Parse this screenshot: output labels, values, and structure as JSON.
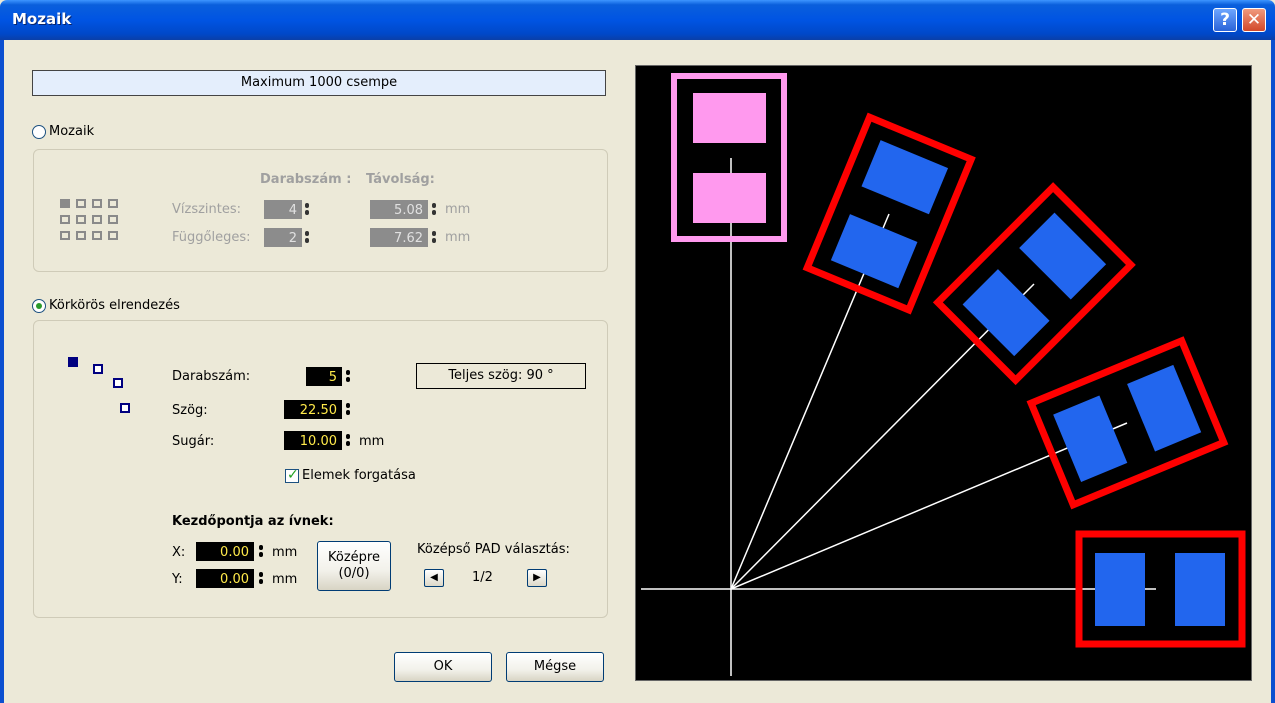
{
  "window": {
    "title": "Mozaik",
    "help_glyph": "?",
    "close_glyph": "✕"
  },
  "info": {
    "text": "Maximum 1000 csempe"
  },
  "mosaic": {
    "radio_label": "Mozaik",
    "selected": false,
    "col_count_header": "Darabszám :",
    "col_distance_header": "Távolság:",
    "rows": [
      {
        "label": "Vízszintes:",
        "count": "4",
        "distance": "5.08",
        "unit": "mm"
      },
      {
        "label": "Függőleges:",
        "count": "2",
        "distance": "7.62",
        "unit": "mm"
      }
    ],
    "grid_icon": "grid-icon"
  },
  "circular": {
    "radio_label": "Körkörös elrendezés",
    "selected": true,
    "count_label": "Darabszám:",
    "count_value": "5",
    "angle_label": "Szög:",
    "angle_value": "22.50",
    "radius_label": "Sugár:",
    "radius_value": "10.00",
    "radius_unit": "mm",
    "total_angle_text": "Teljes szög:   90 °",
    "rotate_label": "Elemek forgatása",
    "rotate_checked": true,
    "arc_start_title": "Kezdőpontja az ívnek:",
    "x_label": "X:",
    "x_value": "0.00",
    "y_label": "Y:",
    "y_value": "0.00",
    "coord_unit": "mm",
    "center_button_line1": "Középre",
    "center_button_line2": "(0/0)",
    "pad_select_label": "Középső PAD választás:",
    "pad_page": "1/2",
    "prev_glyph": "◀",
    "next_glyph": "▶"
  },
  "buttons": {
    "ok": "OK",
    "cancel": "Mégse"
  },
  "colors": {
    "titlebar": "#0054e3",
    "preview_bg": "#000000",
    "first_outline": "#ff99ee",
    "first_pad": "#ff99ee",
    "outline": "#ff0000",
    "pad": "#2266ee",
    "guide_line": "#ffffff"
  }
}
